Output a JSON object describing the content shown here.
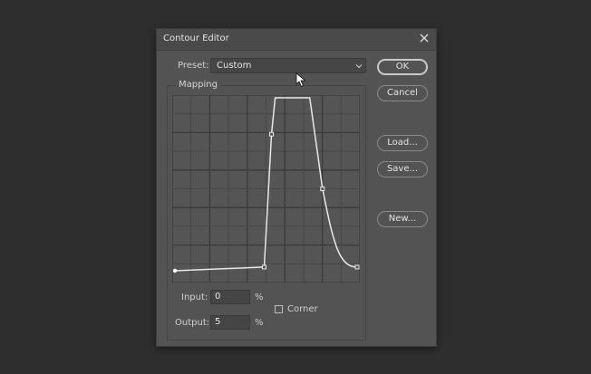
{
  "dialog": {
    "title": "Contour Editor",
    "preset_label": "Preset:",
    "preset_value": "Custom",
    "mapping_label": "Mapping",
    "input_label": "Input:",
    "input_value": "0",
    "input_unit": "%",
    "output_label": "Output:",
    "output_value": "5",
    "output_unit": "%",
    "corner_label": "Corner",
    "corner_checked": false
  },
  "buttons": {
    "ok": "OK",
    "cancel": "Cancel",
    "load": "Load...",
    "save": "Save...",
    "new": "New..."
  },
  "icons": {
    "close": "close-icon",
    "dropdown": "chevron-down-icon",
    "cursor": "mouse-pointer-icon"
  },
  "colors": {
    "background": "#2e2e2e",
    "dialog": "#535353",
    "curve": "#e8e8e8",
    "grid_fine": "#474747",
    "grid_major": "#3a3a3a"
  },
  "curve": {
    "mode": "input-output mapping",
    "points": [
      {
        "input": 0,
        "output": 5
      },
      {
        "input": 49,
        "output": 7
      },
      {
        "input": 53,
        "output": 80
      },
      {
        "input": 55,
        "output": 100
      },
      {
        "input": 74,
        "output": 100
      },
      {
        "input": 81,
        "output": 50
      },
      {
        "input": 100,
        "output": 7
      }
    ]
  }
}
